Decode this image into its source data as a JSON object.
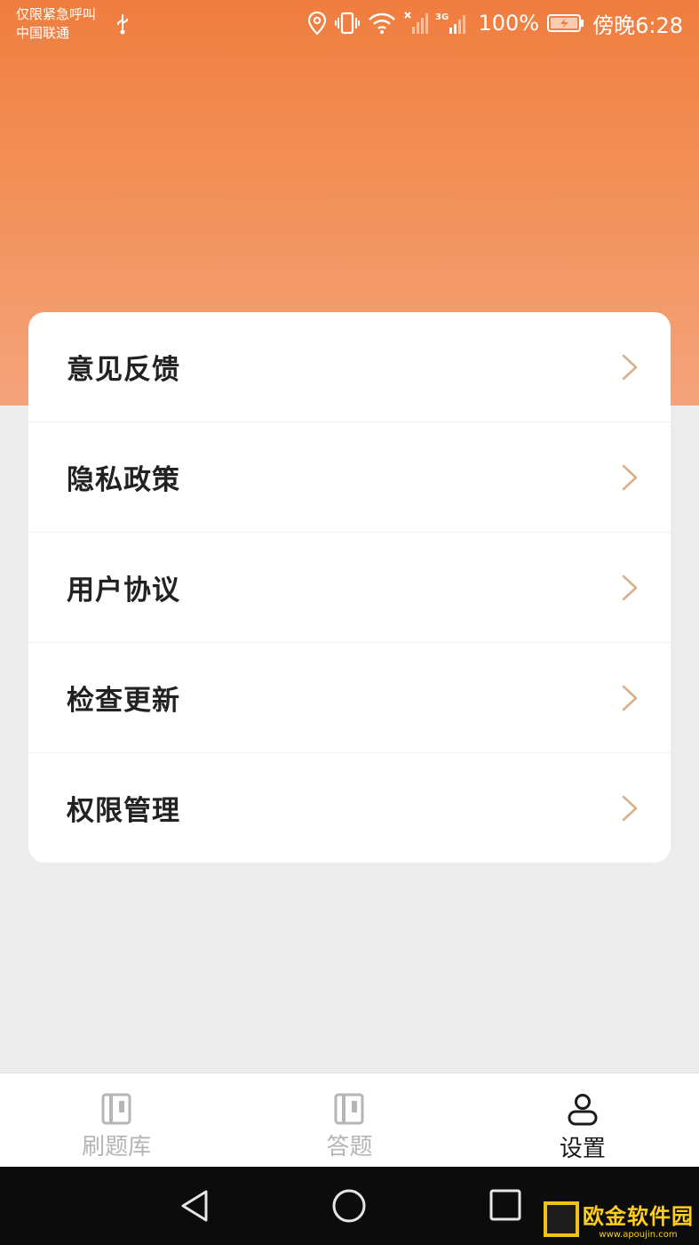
{
  "status_bar": {
    "carrier_line1": "仅限紧急呼叫",
    "carrier_line2": "中国联通",
    "network": "3G",
    "battery": "100%",
    "time": "傍晚6:28"
  },
  "menu": {
    "items": [
      {
        "label": "意见反馈"
      },
      {
        "label": "隐私政策"
      },
      {
        "label": "用户协议"
      },
      {
        "label": "检查更新"
      },
      {
        "label": "权限管理"
      }
    ]
  },
  "tabs": [
    {
      "label": "刷题库",
      "icon": "book-icon",
      "active": false
    },
    {
      "label": "答题",
      "icon": "book-icon",
      "active": false
    },
    {
      "label": "设置",
      "icon": "person-icon",
      "active": true
    }
  ],
  "watermark": {
    "text": "欧金软件园",
    "url": "www.apoujin.com"
  },
  "colors": {
    "header_top": "#f07d3f",
    "header_bottom": "#f4a37c",
    "chevron": "#d9b08c",
    "background": "#ececec"
  }
}
